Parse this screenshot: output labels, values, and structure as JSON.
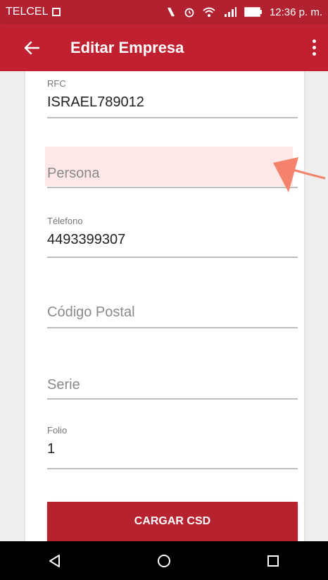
{
  "status_bar": {
    "carrier": "TELCEL",
    "time": "12:36 p. m."
  },
  "app_bar": {
    "title": "Editar Empresa"
  },
  "form": {
    "rfc": {
      "label": "RFC",
      "value": "ISRAEL789012"
    },
    "persona": {
      "placeholder": "Persona"
    },
    "telefono": {
      "label": "Télefono",
      "value": "4493399307"
    },
    "codigo_postal": {
      "placeholder": "Código Postal"
    },
    "serie": {
      "placeholder": "Serie"
    },
    "folio": {
      "label": "Folio",
      "value": "1"
    }
  },
  "buttons": {
    "cargar_csd": "CARGAR CSD"
  },
  "colors": {
    "status_bar": "#b1212f",
    "app_bar": "#c0202f",
    "button": "#b7222f",
    "highlight": "#fde7e7",
    "annotation": "#f4826c"
  }
}
